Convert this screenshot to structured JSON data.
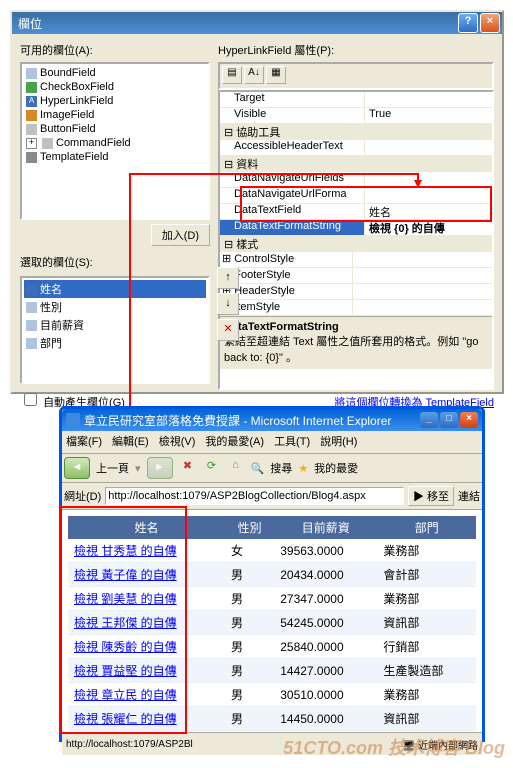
{
  "dialog": {
    "title": "欄位",
    "availableLabel": "可用的欄位(A):",
    "fields": [
      "BoundField",
      "CheckBoxField",
      "HyperLinkField",
      "ImageField",
      "ButtonField",
      "CommandField",
      "TemplateField"
    ],
    "addBtn": "加入(D)",
    "selectedLabel": "選取的欄位(S):",
    "selected": [
      "姓名",
      "性別",
      "目前薪資",
      "部門"
    ],
    "autoGen": "自動產生欄位(G)",
    "propLabel": "HyperLinkField 屬性(P):",
    "props": {
      "target": "Target",
      "visible": "Visible",
      "visibleV": "True",
      "cat1": "協助工具",
      "aht": "AccessibleHeaderText",
      "cat2": "資料",
      "dnuf": "DataNavigateUrlFields",
      "dnufs": "DataNavigateUrlForma",
      "dtf": "DataTextField",
      "dtfv": "姓名",
      "dtfs": "DataTextFormatString",
      "dtfsv": "檢視 {0} 的自傳",
      "cat3": "樣式",
      "cs": "ControlStyle",
      "fs": "FooterStyle",
      "hs": "HeaderStyle",
      "is": "ItemStyle"
    },
    "descTitle": "DataTextFormatString",
    "descText": "繫結至超連結 Text 屬性之值所套用的格式。例如 \"go back to: {0}\" 。",
    "convertLink": "將這個欄位轉換為 TemplateField"
  },
  "ie": {
    "title": "章立民研究室部落格免費授課 - Microsoft Internet Explorer",
    "menu": [
      "檔案(F)",
      "編輯(E)",
      "檢視(V)",
      "我的最愛(A)",
      "工具(T)",
      "說明(H)"
    ],
    "back": "上一頁",
    "search": "搜尋",
    "fav": "我的最愛",
    "addrLbl": "網址(D)",
    "url": "http://localhost:1079/ASP2BlogCollection/Blog4.aspx",
    "go": "移至",
    "links": "連結",
    "headers": [
      "姓名",
      "性別",
      "目前薪資",
      "部門"
    ],
    "rows": [
      {
        "n": "檢視 甘秀慧 的自傳",
        "s": "女",
        "sal": "39563.0000",
        "d": "業務部"
      },
      {
        "n": "檢視 黃子偉 的自傳",
        "s": "男",
        "sal": "20434.0000",
        "d": "會計部"
      },
      {
        "n": "檢視 劉美慧 的自傳",
        "s": "男",
        "sal": "27347.0000",
        "d": "業務部"
      },
      {
        "n": "檢視 王邦傑 的自傳",
        "s": "男",
        "sal": "54245.0000",
        "d": "資訊部"
      },
      {
        "n": "檢視 陳秀齡 的自傳",
        "s": "男",
        "sal": "25840.0000",
        "d": "行銷部"
      },
      {
        "n": "檢視 賈益堅 的自傳",
        "s": "男",
        "sal": "14427.0000",
        "d": "生產製造部"
      },
      {
        "n": "檢視 章立民 的自傳",
        "s": "男",
        "sal": "30510.0000",
        "d": "業務部"
      },
      {
        "n": "檢視 張耀仁 的自傳",
        "s": "男",
        "sal": "14450.0000",
        "d": "資訊部"
      }
    ],
    "status": "http://localhost:1079/ASP2Bl",
    "zone": "近端內部網路"
  },
  "watermark": "51CTO.com 技术博客 Blog"
}
